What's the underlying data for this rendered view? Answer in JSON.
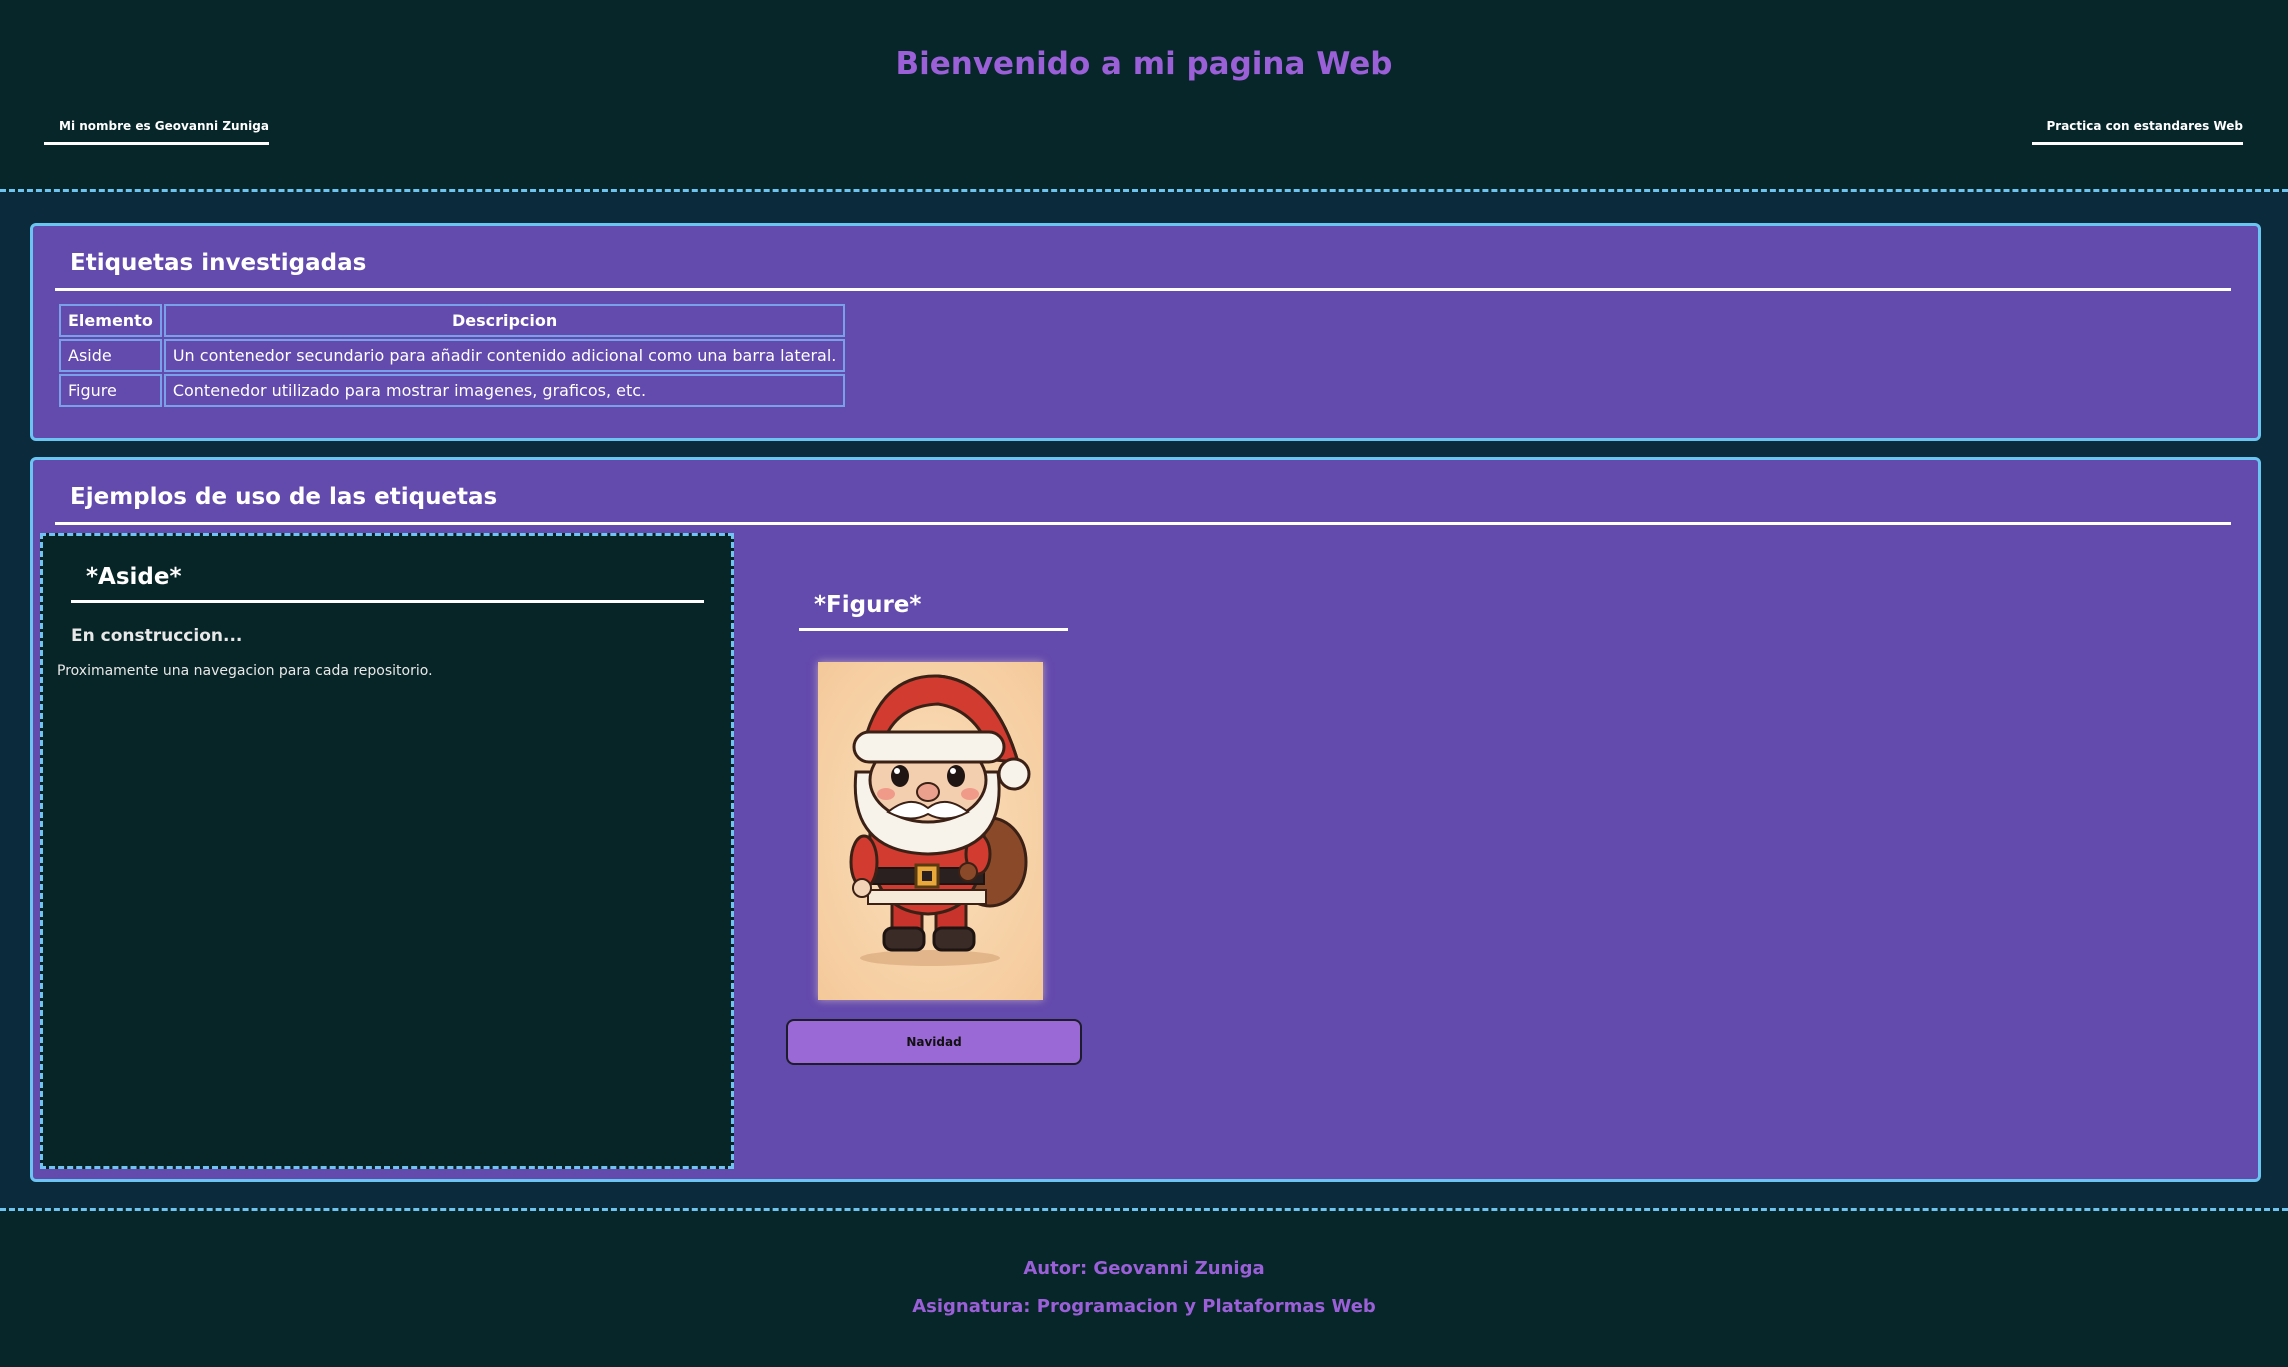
{
  "header": {
    "title": "Bienvenido a mi pagina Web",
    "nav_left": "Mi nombre es Geovanni Zuniga",
    "nav_right": "Practica con estandares Web"
  },
  "section_tags": {
    "heading": "Etiquetas investigadas",
    "table": {
      "headers": [
        "Elemento",
        "Descripcion"
      ],
      "rows": [
        [
          "Aside",
          "Un contenedor secundario para añadir contenido adicional como una barra lateral."
        ],
        [
          "Figure",
          "Contenedor utilizado para mostrar imagenes, graficos, etc."
        ]
      ]
    }
  },
  "section_examples": {
    "heading": "Ejemplos de uso de las etiquetas",
    "aside": {
      "heading": "*Aside*",
      "subtitle": "En construccion...",
      "text": "Proximamente una navegacion para cada repositorio."
    },
    "figure": {
      "heading": "*Figure*",
      "image_icon": "santa-claus-illustration",
      "caption": "Navidad"
    }
  },
  "footer": {
    "author": "Autor: Geovanni Zuniga",
    "course": "Asignatura: Programacion y Plataformas Web"
  },
  "colors": {
    "background": "#062629",
    "main_band": "#0b2b3c",
    "section_bg": "#634aad",
    "section_border": "#6bc5f3",
    "accent_purple": "#9b5fd8",
    "caption_bg": "#9b69d6"
  }
}
